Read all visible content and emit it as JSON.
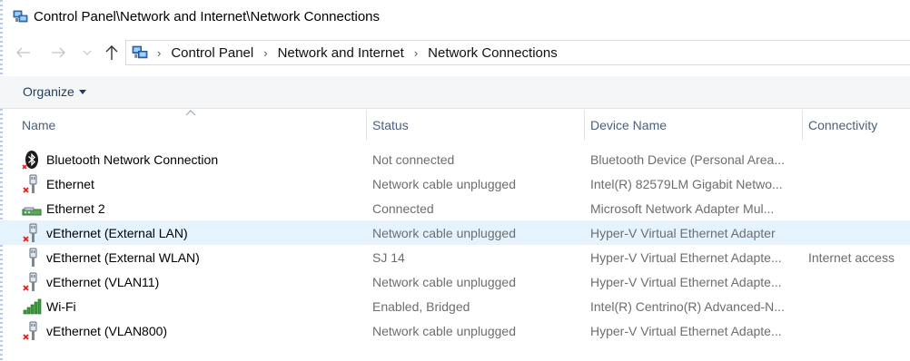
{
  "window": {
    "title": "Control Panel\\Network and Internet\\Network Connections"
  },
  "nav": {
    "back_icon": "arrow-left-icon",
    "forward_icon": "arrow-right-icon",
    "recent_icon": "chevron-down-icon",
    "up_icon": "arrow-up-icon",
    "breadcrumb": [
      "Control Panel",
      "Network and Internet",
      "Network Connections"
    ]
  },
  "commandbar": {
    "organize_label": "Organize"
  },
  "columns": {
    "name": "Name",
    "status": "Status",
    "device": "Device Name",
    "connectivity": "Connectivity"
  },
  "connections": [
    {
      "name": "Bluetooth Network Connection",
      "status": "Not connected",
      "device": "Bluetooth Device (Personal Area...",
      "connectivity": "",
      "icon": "bluetooth-icon"
    },
    {
      "name": "Ethernet",
      "status": "Network cable unplugged",
      "device": "Intel(R) 82579LM Gigabit Netwo...",
      "connectivity": "",
      "icon": "ethernet-unplugged-icon"
    },
    {
      "name": "Ethernet 2",
      "status": "Connected",
      "device": "Microsoft Network Adapter Mul...",
      "connectivity": "",
      "icon": "ethernet-connected-icon"
    },
    {
      "name": "vEthernet (External LAN)",
      "status": "Network cable unplugged",
      "device": "Hyper-V Virtual Ethernet Adapter",
      "connectivity": "",
      "icon": "ethernet-unplugged-icon"
    },
    {
      "name": "vEthernet (External WLAN)",
      "status": "SJ  14",
      "device": "Hyper-V Virtual Ethernet Adapte...",
      "connectivity": "Internet access",
      "icon": "ethernet-icon"
    },
    {
      "name": "vEthernet (VLAN11)",
      "status": "Network cable unplugged",
      "device": "Hyper-V Virtual Ethernet Adapte...",
      "connectivity": "",
      "icon": "ethernet-unplugged-icon"
    },
    {
      "name": "Wi-Fi",
      "status": "Enabled, Bridged",
      "device": "Intel(R) Centrino(R) Advanced-N...",
      "connectivity": "",
      "icon": "wifi-signal-icon"
    },
    {
      "name": "vEthernet (VLAN800)",
      "status": "Network cable unplugged",
      "device": "Hyper-V Virtual Ethernet Adapte...",
      "connectivity": "",
      "icon": "ethernet-unplugged-icon"
    }
  ],
  "selected_row": 3,
  "colors": {
    "selection": "#e5f3ff",
    "header_text": "#4c607a",
    "secondary_text": "#6d6d6d",
    "organize_text": "#1e3e5b"
  }
}
